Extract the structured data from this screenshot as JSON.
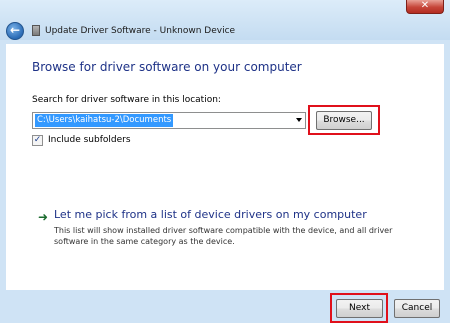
{
  "window": {
    "title": "Update Driver Software - Unknown Device",
    "back_icon": "back-arrow-icon",
    "close_symbol": "✕"
  },
  "main": {
    "heading": "Browse for driver software on your computer",
    "search_label": "Search for driver software in this location:",
    "path_value": "C:\\Users\\kaihatsu-2\\Documents",
    "browse_label": "Browse...",
    "include_subfolders": {
      "label": "Include subfolders",
      "checked": true,
      "mark": "✓"
    },
    "pick_option": {
      "arrow": "➜",
      "title": "Let me pick from a list of device drivers on my computer",
      "description": "This list will show installed driver software compatible with the device, and all driver software in the same category as the device."
    }
  },
  "footer": {
    "next_label": "Next",
    "cancel_label": "Cancel"
  },
  "colors": {
    "heading": "#1e3287",
    "highlight": "#e0101b",
    "selection": "#3399ff"
  }
}
